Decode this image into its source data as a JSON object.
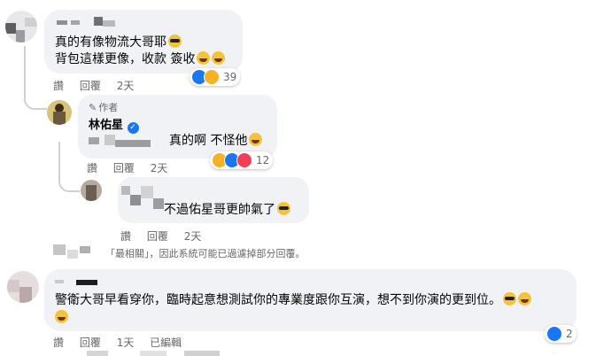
{
  "comments": [
    {
      "lines": [
        "真的有像物流大哥耶",
        "背包這樣更像，收款 簽收"
      ],
      "actions": [
        "讚",
        "回覆",
        "2天"
      ],
      "reaction_count": "39"
    },
    {
      "badge": "作者",
      "author": "林佑星",
      "text": "真的啊 不怪他",
      "actions": [
        "讚",
        "回覆",
        "2天"
      ],
      "reaction_count": "12"
    },
    {
      "text": "不過佑星哥更帥氣了",
      "actions": [
        "讚",
        "回覆",
        "2天"
      ]
    },
    {
      "lines": [
        "警衛大哥早看穿你，臨時起意想測試你的專業度跟你互演，想不到你演的更到位。"
      ],
      "actions": [
        "讚",
        "回覆",
        "1天",
        "已編輯"
      ],
      "reaction_count": "2"
    }
  ],
  "filter_notice": "「最相關」，因此系統可能已過濾掉部分回覆。",
  "icons": [
    "sunglasses-emoji",
    "grin-emoji",
    "laugh-emoji",
    "like-reaction",
    "haha-reaction",
    "love-reaction",
    "verified-badge-icon",
    "pen-icon"
  ],
  "colors": {
    "like_blue": "#1877f2",
    "love_red": "#f33e58",
    "verified": "#1877f2",
    "bubble": "#f0f2f5"
  }
}
